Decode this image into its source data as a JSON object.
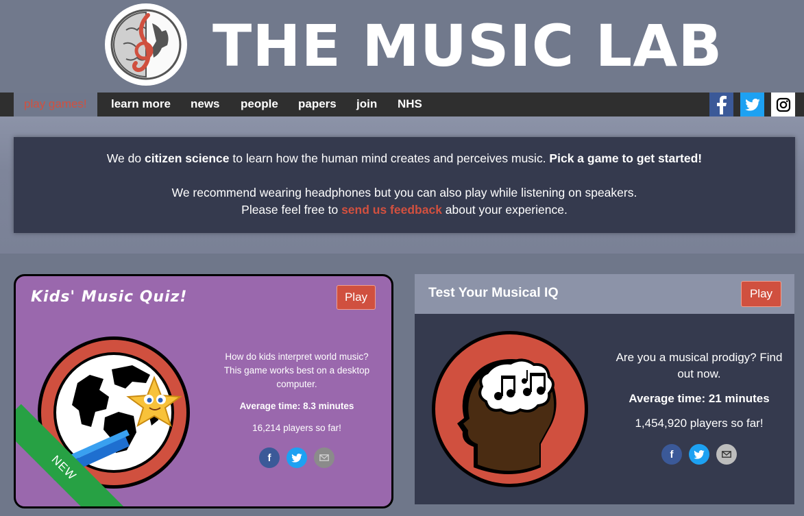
{
  "header": {
    "title": "THE MUSIC LAB"
  },
  "nav": {
    "items": [
      {
        "label": "play games!",
        "active": true
      },
      {
        "label": "learn more"
      },
      {
        "label": "news"
      },
      {
        "label": "people"
      },
      {
        "label": "papers"
      },
      {
        "label": "join"
      },
      {
        "label": "NHS"
      }
    ],
    "social": [
      "facebook-icon",
      "twitter-icon",
      "instagram-icon"
    ]
  },
  "intro": {
    "line1_a": "We do ",
    "line1_b": "citizen science",
    "line1_c": " to learn how the human mind creates and perceives music. ",
    "line1_d": "Pick a game to get started!",
    "line2": "We recommend wearing headphones but you can also play while listening on speakers.",
    "line3_a": "Please feel free to ",
    "line3_link": "send us feedback",
    "line3_b": " about your experience."
  },
  "games": [
    {
      "title": "Kids' Music Quiz!",
      "play_label": "Play",
      "description": "How do kids interpret world music? This game works best on a desktop computer.",
      "avg_time": "Average time: 8.3 minutes",
      "players": "16,214 players so far!",
      "badge": "NEW"
    },
    {
      "title": "Test Your Musical IQ",
      "play_label": "Play",
      "description": "Are you a musical prodigy? Find out now.",
      "avg_time": "Average time: 21 minutes",
      "players": "1,454,920 players so far!"
    }
  ],
  "colors": {
    "accent_red": "#d0503f",
    "nav_bg": "#2f2f2f",
    "card_purple": "#9a68ad",
    "card_dark": "#353a4e",
    "new_green": "#27a144",
    "facebook": "#3b5998",
    "twitter": "#1da1f2"
  }
}
